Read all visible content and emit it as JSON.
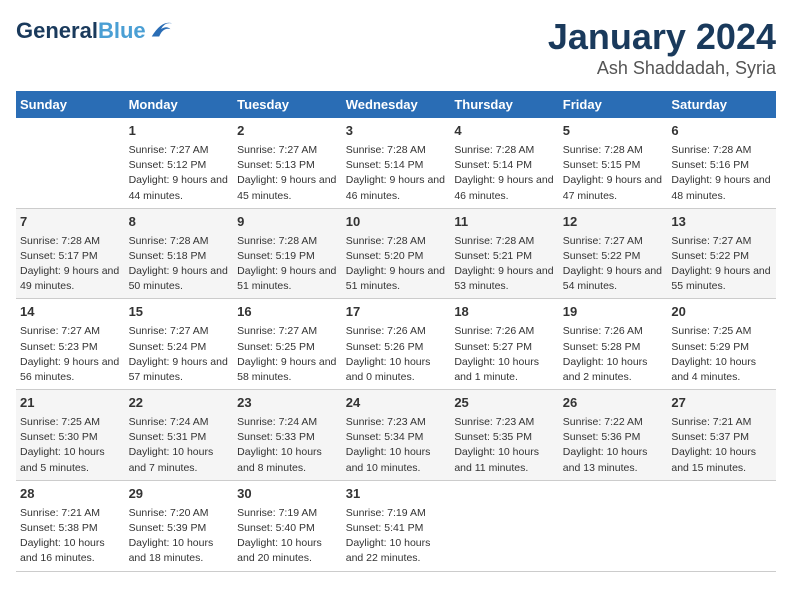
{
  "logo": {
    "line1": "General",
    "line2": "Blue"
  },
  "title": "January 2024",
  "subtitle": "Ash Shaddadah, Syria",
  "days_of_week": [
    "Sunday",
    "Monday",
    "Tuesday",
    "Wednesday",
    "Thursday",
    "Friday",
    "Saturday"
  ],
  "weeks": [
    [
      {
        "day": "",
        "sunrise": "",
        "sunset": "",
        "daylight": ""
      },
      {
        "day": "1",
        "sunrise": "Sunrise: 7:27 AM",
        "sunset": "Sunset: 5:12 PM",
        "daylight": "Daylight: 9 hours and 44 minutes."
      },
      {
        "day": "2",
        "sunrise": "Sunrise: 7:27 AM",
        "sunset": "Sunset: 5:13 PM",
        "daylight": "Daylight: 9 hours and 45 minutes."
      },
      {
        "day": "3",
        "sunrise": "Sunrise: 7:28 AM",
        "sunset": "Sunset: 5:14 PM",
        "daylight": "Daylight: 9 hours and 46 minutes."
      },
      {
        "day": "4",
        "sunrise": "Sunrise: 7:28 AM",
        "sunset": "Sunset: 5:14 PM",
        "daylight": "Daylight: 9 hours and 46 minutes."
      },
      {
        "day": "5",
        "sunrise": "Sunrise: 7:28 AM",
        "sunset": "Sunset: 5:15 PM",
        "daylight": "Daylight: 9 hours and 47 minutes."
      },
      {
        "day": "6",
        "sunrise": "Sunrise: 7:28 AM",
        "sunset": "Sunset: 5:16 PM",
        "daylight": "Daylight: 9 hours and 48 minutes."
      }
    ],
    [
      {
        "day": "7",
        "sunrise": "Sunrise: 7:28 AM",
        "sunset": "Sunset: 5:17 PM",
        "daylight": "Daylight: 9 hours and 49 minutes."
      },
      {
        "day": "8",
        "sunrise": "Sunrise: 7:28 AM",
        "sunset": "Sunset: 5:18 PM",
        "daylight": "Daylight: 9 hours and 50 minutes."
      },
      {
        "day": "9",
        "sunrise": "Sunrise: 7:28 AM",
        "sunset": "Sunset: 5:19 PM",
        "daylight": "Daylight: 9 hours and 51 minutes."
      },
      {
        "day": "10",
        "sunrise": "Sunrise: 7:28 AM",
        "sunset": "Sunset: 5:20 PM",
        "daylight": "Daylight: 9 hours and 51 minutes."
      },
      {
        "day": "11",
        "sunrise": "Sunrise: 7:28 AM",
        "sunset": "Sunset: 5:21 PM",
        "daylight": "Daylight: 9 hours and 53 minutes."
      },
      {
        "day": "12",
        "sunrise": "Sunrise: 7:27 AM",
        "sunset": "Sunset: 5:22 PM",
        "daylight": "Daylight: 9 hours and 54 minutes."
      },
      {
        "day": "13",
        "sunrise": "Sunrise: 7:27 AM",
        "sunset": "Sunset: 5:22 PM",
        "daylight": "Daylight: 9 hours and 55 minutes."
      }
    ],
    [
      {
        "day": "14",
        "sunrise": "Sunrise: 7:27 AM",
        "sunset": "Sunset: 5:23 PM",
        "daylight": "Daylight: 9 hours and 56 minutes."
      },
      {
        "day": "15",
        "sunrise": "Sunrise: 7:27 AM",
        "sunset": "Sunset: 5:24 PM",
        "daylight": "Daylight: 9 hours and 57 minutes."
      },
      {
        "day": "16",
        "sunrise": "Sunrise: 7:27 AM",
        "sunset": "Sunset: 5:25 PM",
        "daylight": "Daylight: 9 hours and 58 minutes."
      },
      {
        "day": "17",
        "sunrise": "Sunrise: 7:26 AM",
        "sunset": "Sunset: 5:26 PM",
        "daylight": "Daylight: 10 hours and 0 minutes."
      },
      {
        "day": "18",
        "sunrise": "Sunrise: 7:26 AM",
        "sunset": "Sunset: 5:27 PM",
        "daylight": "Daylight: 10 hours and 1 minute."
      },
      {
        "day": "19",
        "sunrise": "Sunrise: 7:26 AM",
        "sunset": "Sunset: 5:28 PM",
        "daylight": "Daylight: 10 hours and 2 minutes."
      },
      {
        "day": "20",
        "sunrise": "Sunrise: 7:25 AM",
        "sunset": "Sunset: 5:29 PM",
        "daylight": "Daylight: 10 hours and 4 minutes."
      }
    ],
    [
      {
        "day": "21",
        "sunrise": "Sunrise: 7:25 AM",
        "sunset": "Sunset: 5:30 PM",
        "daylight": "Daylight: 10 hours and 5 minutes."
      },
      {
        "day": "22",
        "sunrise": "Sunrise: 7:24 AM",
        "sunset": "Sunset: 5:31 PM",
        "daylight": "Daylight: 10 hours and 7 minutes."
      },
      {
        "day": "23",
        "sunrise": "Sunrise: 7:24 AM",
        "sunset": "Sunset: 5:33 PM",
        "daylight": "Daylight: 10 hours and 8 minutes."
      },
      {
        "day": "24",
        "sunrise": "Sunrise: 7:23 AM",
        "sunset": "Sunset: 5:34 PM",
        "daylight": "Daylight: 10 hours and 10 minutes."
      },
      {
        "day": "25",
        "sunrise": "Sunrise: 7:23 AM",
        "sunset": "Sunset: 5:35 PM",
        "daylight": "Daylight: 10 hours and 11 minutes."
      },
      {
        "day": "26",
        "sunrise": "Sunrise: 7:22 AM",
        "sunset": "Sunset: 5:36 PM",
        "daylight": "Daylight: 10 hours and 13 minutes."
      },
      {
        "day": "27",
        "sunrise": "Sunrise: 7:21 AM",
        "sunset": "Sunset: 5:37 PM",
        "daylight": "Daylight: 10 hours and 15 minutes."
      }
    ],
    [
      {
        "day": "28",
        "sunrise": "Sunrise: 7:21 AM",
        "sunset": "Sunset: 5:38 PM",
        "daylight": "Daylight: 10 hours and 16 minutes."
      },
      {
        "day": "29",
        "sunrise": "Sunrise: 7:20 AM",
        "sunset": "Sunset: 5:39 PM",
        "daylight": "Daylight: 10 hours and 18 minutes."
      },
      {
        "day": "30",
        "sunrise": "Sunrise: 7:19 AM",
        "sunset": "Sunset: 5:40 PM",
        "daylight": "Daylight: 10 hours and 20 minutes."
      },
      {
        "day": "31",
        "sunrise": "Sunrise: 7:19 AM",
        "sunset": "Sunset: 5:41 PM",
        "daylight": "Daylight: 10 hours and 22 minutes."
      },
      {
        "day": "",
        "sunrise": "",
        "sunset": "",
        "daylight": ""
      },
      {
        "day": "",
        "sunrise": "",
        "sunset": "",
        "daylight": ""
      },
      {
        "day": "",
        "sunrise": "",
        "sunset": "",
        "daylight": ""
      }
    ]
  ]
}
